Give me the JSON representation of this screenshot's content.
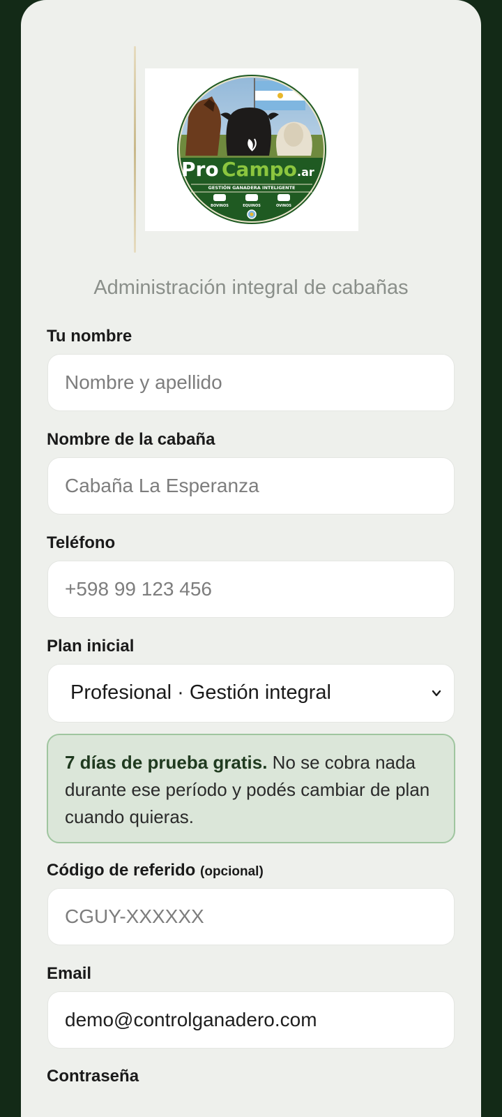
{
  "brand": {
    "logo_text_pro": "Pro",
    "logo_text_campo": "Campo",
    "logo_text_ar": ".ar",
    "logo_tagline": "GESTIÓN GANADERA INTELIGENTE",
    "logo_categories": [
      "BOVINOS",
      "EQUINOS",
      "OVINOS"
    ]
  },
  "subtitle": "Administración integral de cabañas",
  "form": {
    "name": {
      "label": "Tu nombre",
      "placeholder": "Nombre y apellido",
      "value": ""
    },
    "cabin": {
      "label": "Nombre de la cabaña",
      "placeholder": "Cabaña La Esperanza",
      "value": ""
    },
    "phone": {
      "label": "Teléfono",
      "placeholder": "+598 99 123 456",
      "value": ""
    },
    "plan": {
      "label": "Plan inicial",
      "selected": "Profesional · Gestión integral"
    },
    "notice": {
      "bold": "7 días de prueba gratis.",
      "text": " No se cobra nada durante ese período y podés cambiar de plan cuando quieras."
    },
    "referral": {
      "label": "Código de referido",
      "optional": "(opcional)",
      "placeholder": "CGUY-XXXXXX",
      "value": ""
    },
    "email": {
      "label": "Email",
      "placeholder": "",
      "value": "demo@controlganadero.com"
    },
    "password": {
      "label": "Contraseña"
    }
  },
  "colors": {
    "background": "#132a17",
    "card": "#eef0ec",
    "notice_bg": "#dbe6d9",
    "notice_border": "#9fc59f",
    "brand_green": "#1f5a22"
  }
}
